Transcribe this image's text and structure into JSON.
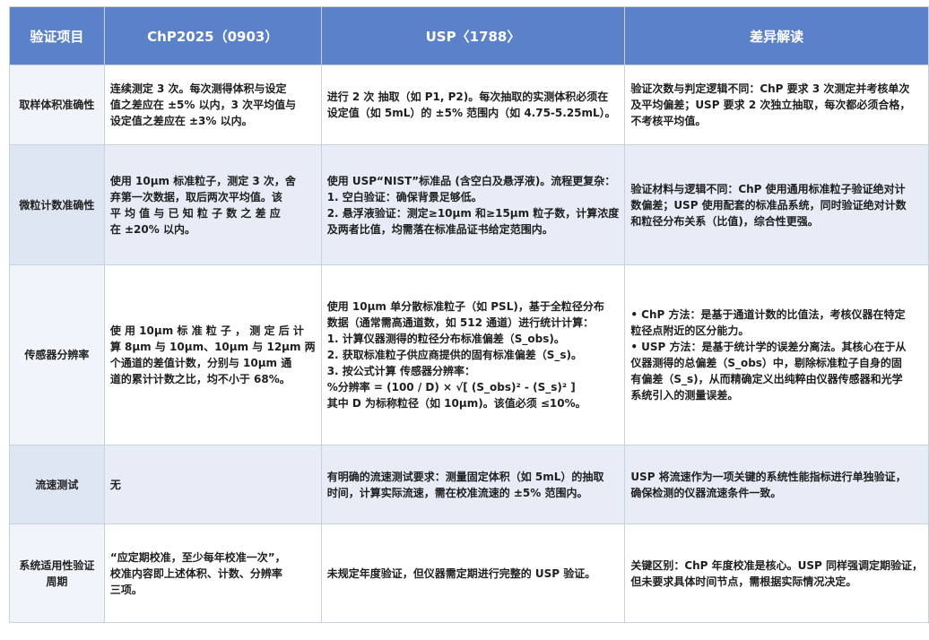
{
  "headers": [
    "验证项目",
    "ChP2025（0903）",
    "USP〈1788〉",
    "差异解读"
  ],
  "rows": [
    {
      "item": "取样体积准确性",
      "chp": [
        "连续测定 3 次。每次测得体积与设定",
        "值之差应在 ±5% 以内，3 次平均值与",
        "设定值之差应在 ±3% 以内。"
      ],
      "usp": [
        "进行 2 次 抽取（如 P1, P2)。每次抽取的实测体积必须在",
        "设定值（如 5mL）的 ±5% 范围内（如 4.75-5.25mL）。"
      ],
      "diff": [
        "验证次数与判定逻辑不同：ChP 要求 3 次测定并考核单次",
        "及平均偏差；USP 要求 2 次独立抽取，每次都必须合格，",
        "不考核平均值。"
      ]
    },
    {
      "item": "微粒计数准确性",
      "chp": [
        "使用 10μm 标准粒子，测定 3 次，舍",
        "弃第一次数据，取后两次平均值。该",
        "平 均 值 与 已 知 粒 子 数 之 差 应",
        "在 ±20% 以内。"
      ],
      "usp": [
        "使用 USP“NIST”标准品 (含空白及悬浮液)。流程更复杂：",
        "1. 空白验证：确保背景足够低。",
        "2. 悬浮液验证：测定≥10μm 和≥15μm 粒子数，计算浓度",
        "及两者比值，均需落在标准品证书给定范围内。"
      ],
      "diff": [
        "验证材料与逻辑不同：ChP 使用通用标准粒子验证绝对计",
        "数偏差；USP 使用配套的标准品系统，同时验证绝对计数",
        "和粒径分布关系（比值)，综合性更强。"
      ]
    },
    {
      "item": "传感器分辨率",
      "chp": [
        "使 用 10μm 标 准 粒 子 ， 测 定 后 计",
        "算 8μm 与 10μm、10μm 与 12μm 两",
        "个通道的差值计数，分别与 10μm 通",
        "道的累计计数之比，均不小于 68%。"
      ],
      "usp": [
        "使用 10μm 单分散标准粒子（如 PSL)，基于全粒径分布",
        "数据（通常需高通道数，如 512 通道）进行统计计算：",
        "1. 计算仪器测得的粒径分布标准偏差（S_obs)。",
        "2. 获取标准粒子供应商提供的固有标准偏差（S_s)。",
        "3. 按公式计算 传感器分辨率：",
        "%分辨率 = (100 / D) × √[ (S_obs)² - (S_s)² ]",
        "其中 D 为标称粒径（如 10μm)。该值必须 ≤10%。"
      ],
      "diff": [
        "• ChP 方法：是基于通道计数的比值法，考核仪器在特定",
        "粒径点附近的区分能力。",
        "• USP 方法：是基于统计学的误差分离法。其核心在于从",
        "仪器测得的总偏差（S_obs）中，剔除标准粒子自身的固",
        "有偏差（S_s)，从而精确定义出纯粹由仪器传感器和光学",
        "系统引入的测量误差。"
      ]
    },
    {
      "item": "流速测试",
      "chp": [
        "无"
      ],
      "usp": [
        "有明确的流速测试要求：测量固定体积（如 5mL）的抽取",
        "时间，计算实际流速，需在校准流速的 ±5% 范围内。"
      ],
      "diff": [
        "USP 将流速作为一项关键的系统性能指标进行单独验证，",
        "确保检测的仪器流速条件一致。"
      ]
    },
    {
      "item": "系统适用性验证周期",
      "chp": [
        "“应定期校准，至少每年校准一次”，",
        "校准内容即上述体积、计数、分辨率",
        "三项。"
      ],
      "usp": [
        "未规定年度验证，但仪器需定期进行完整的 USP 验证。"
      ],
      "diff": [
        "关键区别：ChP 年度校准是核心。USP 同样强调定期验证，",
        "但未要求具体时间节点，需根据实际情况决定。"
      ]
    }
  ]
}
